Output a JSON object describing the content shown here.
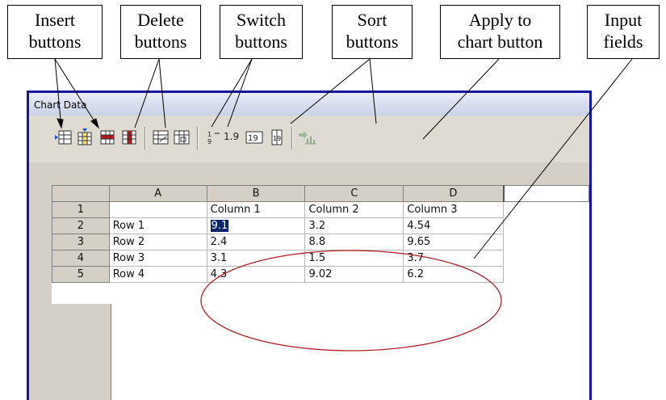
{
  "callouts": {
    "insert": [
      "Insert",
      "buttons"
    ],
    "delete": [
      "Delete",
      "buttons"
    ],
    "switch": [
      "Switch",
      "buttons"
    ],
    "sort": [
      "Sort",
      "buttons"
    ],
    "apply": [
      "Apply to",
      "chart button"
    ],
    "input": [
      "Input",
      "fields"
    ]
  },
  "window": {
    "title": "Chart Data"
  },
  "toolbar": {
    "sort_label_1": "1.9",
    "sort_label_2": "1|9"
  },
  "grid": {
    "col_headers": [
      "A",
      "B",
      "C",
      "D"
    ],
    "row_headers": [
      "1",
      "2",
      "3",
      "4",
      "5"
    ],
    "rows": [
      [
        "",
        "Column 1",
        "Column 2",
        "Column 3"
      ],
      [
        "Row 1",
        "9.1",
        "3.2",
        "4.54"
      ],
      [
        "Row 2",
        "2.4",
        "8.8",
        "9.65"
      ],
      [
        "Row 3",
        "3.1",
        "1.5",
        "3.7"
      ],
      [
        "Row 4",
        "4.3",
        "9.02",
        "6.2"
      ]
    ]
  },
  "colors": {
    "window_border": "#16169a",
    "selection": "#0a246a",
    "ellipse": "#b0202a",
    "delete_red": "#c0101a"
  }
}
